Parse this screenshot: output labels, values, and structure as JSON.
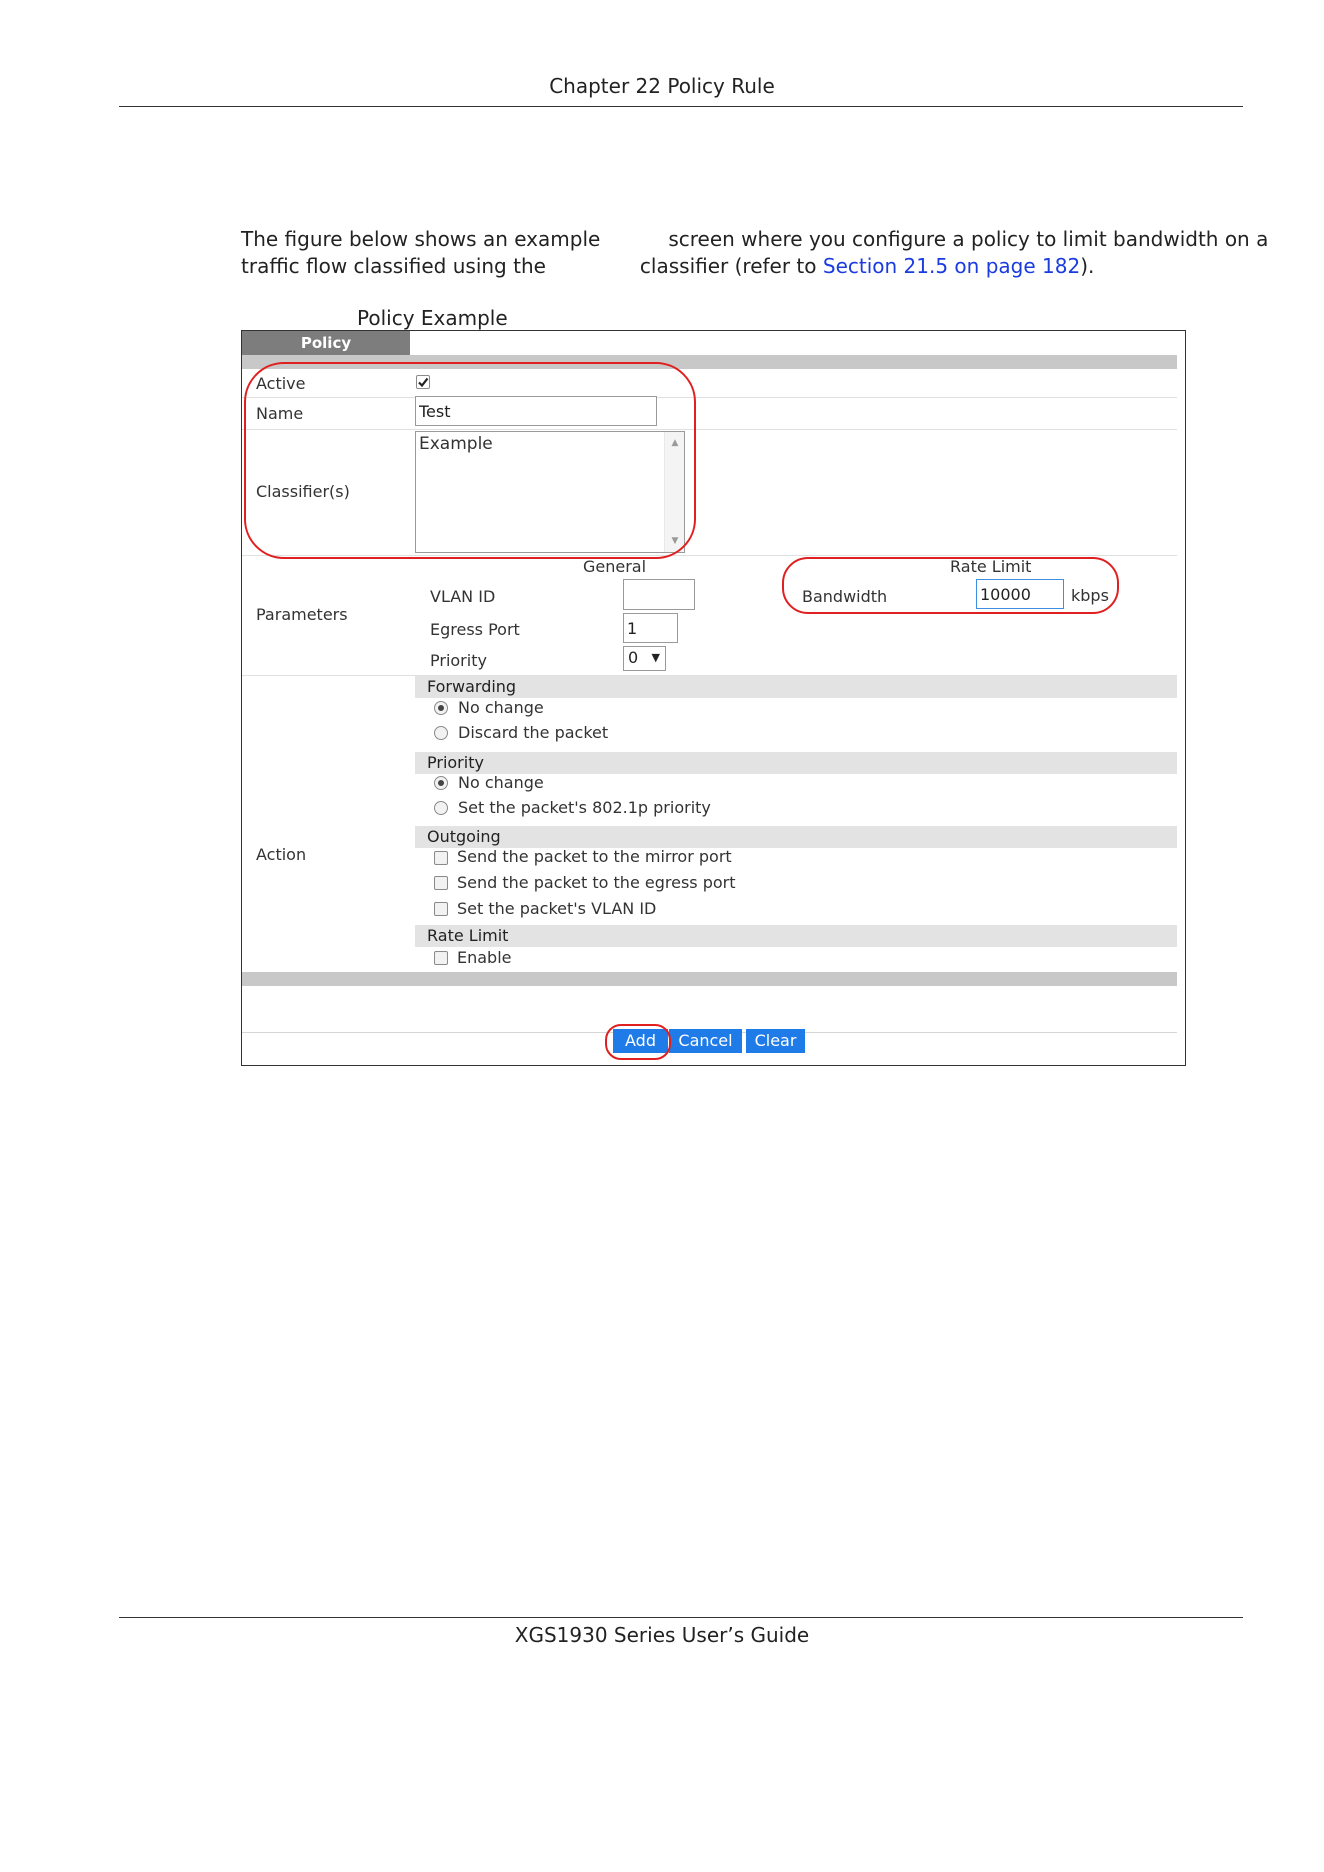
{
  "header": {
    "chapter_title": "Chapter 22 Policy Rule"
  },
  "intro": {
    "line1_a": "The figure below shows an example",
    "line1_b": "screen where you configure a policy to limit bandwidth on a",
    "line2_a": "traffic flow classified using the",
    "line2_b": "classifier (refer to ",
    "link_text": "Section 21.5 on page 182",
    "line2_end": ")."
  },
  "figure": {
    "caption": "Policy Example"
  },
  "policy_form": {
    "tab_label": "Policy",
    "active_label": "Active",
    "active_checked": true,
    "name_label": "Name",
    "name_value": "Test",
    "classifiers_label": "Classifier(s)",
    "classifier_items": [
      "Example"
    ],
    "parameters_label": "Parameters",
    "general_heading": "General",
    "vlan_id_label": "VLAN ID",
    "vlan_id_value": "",
    "egress_port_label": "Egress Port",
    "egress_port_value": "1",
    "priority_label": "Priority",
    "priority_value": "0",
    "rate_limit_heading": "Rate Limit",
    "bandwidth_label": "Bandwidth",
    "bandwidth_value": "10000",
    "bandwidth_unit": "kbps",
    "action_label": "Action",
    "forwarding_heading": "Forwarding",
    "forwarding_no_change": "No change",
    "forwarding_discard": "Discard the packet",
    "priority_heading": "Priority",
    "priority_no_change": "No change",
    "priority_set": "Set the packet's 802.1p priority",
    "outgoing_heading": "Outgoing",
    "outgoing_mirror": "Send the packet to the mirror port",
    "outgoing_egress": "Send the packet to the egress port",
    "outgoing_vlan": "Set the packet's VLAN ID",
    "rate_limit_section_heading": "Rate Limit",
    "rate_limit_enable": "Enable",
    "add_button": "Add",
    "cancel_button": "Cancel",
    "clear_button": "Clear"
  },
  "colors": {
    "button_blue": "#1e7be8",
    "callout_red": "#e02020",
    "tab_gray": "#7d7d7d",
    "link_blue": "#1a3be0"
  },
  "footer": {
    "guide_title": "XGS1930 Series User’s Guide"
  }
}
